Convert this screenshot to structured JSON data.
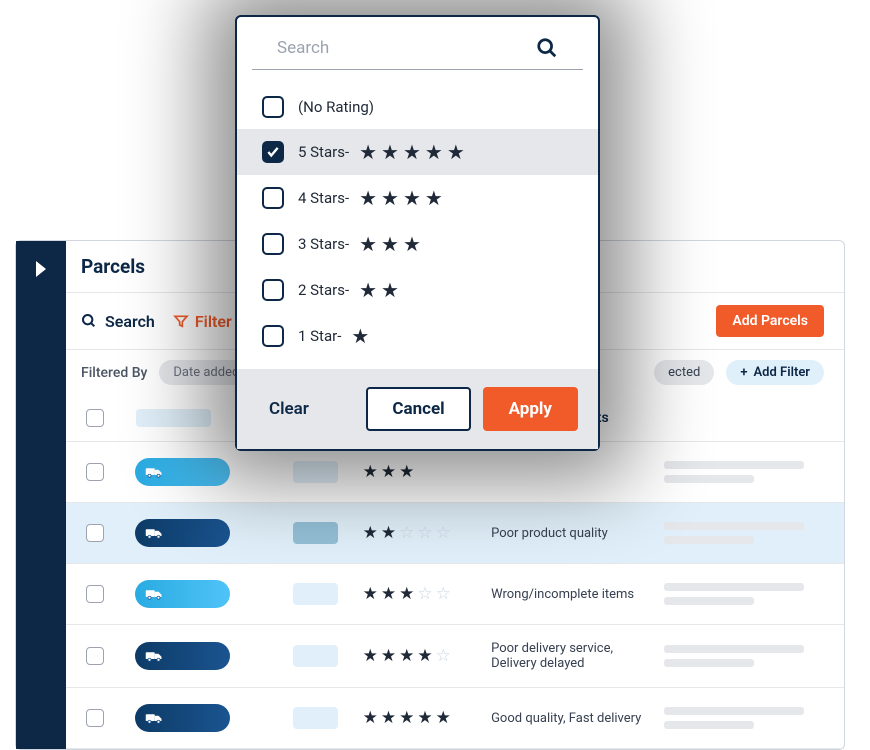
{
  "panel": {
    "title": "Parcels",
    "search_label": "Search",
    "filter_label": "Filter",
    "add_button": "Add Parcels",
    "filtered_by_label": "Filtered By",
    "filter_chips": [
      "Date added",
      "ected"
    ],
    "add_filter_label": "Add Filter",
    "rating_comments_header": "Rating Comments"
  },
  "rows": [
    {
      "badge_color": "light",
      "stars": 3,
      "of": 3,
      "comment": ""
    },
    {
      "badge_color": "dark",
      "stars": 2,
      "of": 5,
      "comment": "Poor product quality",
      "highlighted": true
    },
    {
      "badge_color": "light",
      "stars": 3,
      "of": 5,
      "comment": "Wrong/incomplete items"
    },
    {
      "badge_color": "dark",
      "stars": 4,
      "of": 5,
      "comment": "Poor delivery service, Delivery delayed"
    },
    {
      "badge_color": "dark",
      "stars": 5,
      "of": 5,
      "comment": "Good quality, Fast delivery"
    }
  ],
  "modal": {
    "search_placeholder": "Search",
    "options": [
      {
        "label": "(No Rating)",
        "stars": 0,
        "checked": false
      },
      {
        "label": "5 Stars-",
        "stars": 5,
        "checked": true
      },
      {
        "label": "4 Stars-",
        "stars": 4,
        "checked": false
      },
      {
        "label": "3 Stars-",
        "stars": 3,
        "checked": false
      },
      {
        "label": "2 Stars-",
        "stars": 2,
        "checked": false
      },
      {
        "label": "1 Star-",
        "stars": 1,
        "checked": false
      }
    ],
    "clear_label": "Clear",
    "cancel_label": "Cancel",
    "apply_label": "Apply"
  }
}
